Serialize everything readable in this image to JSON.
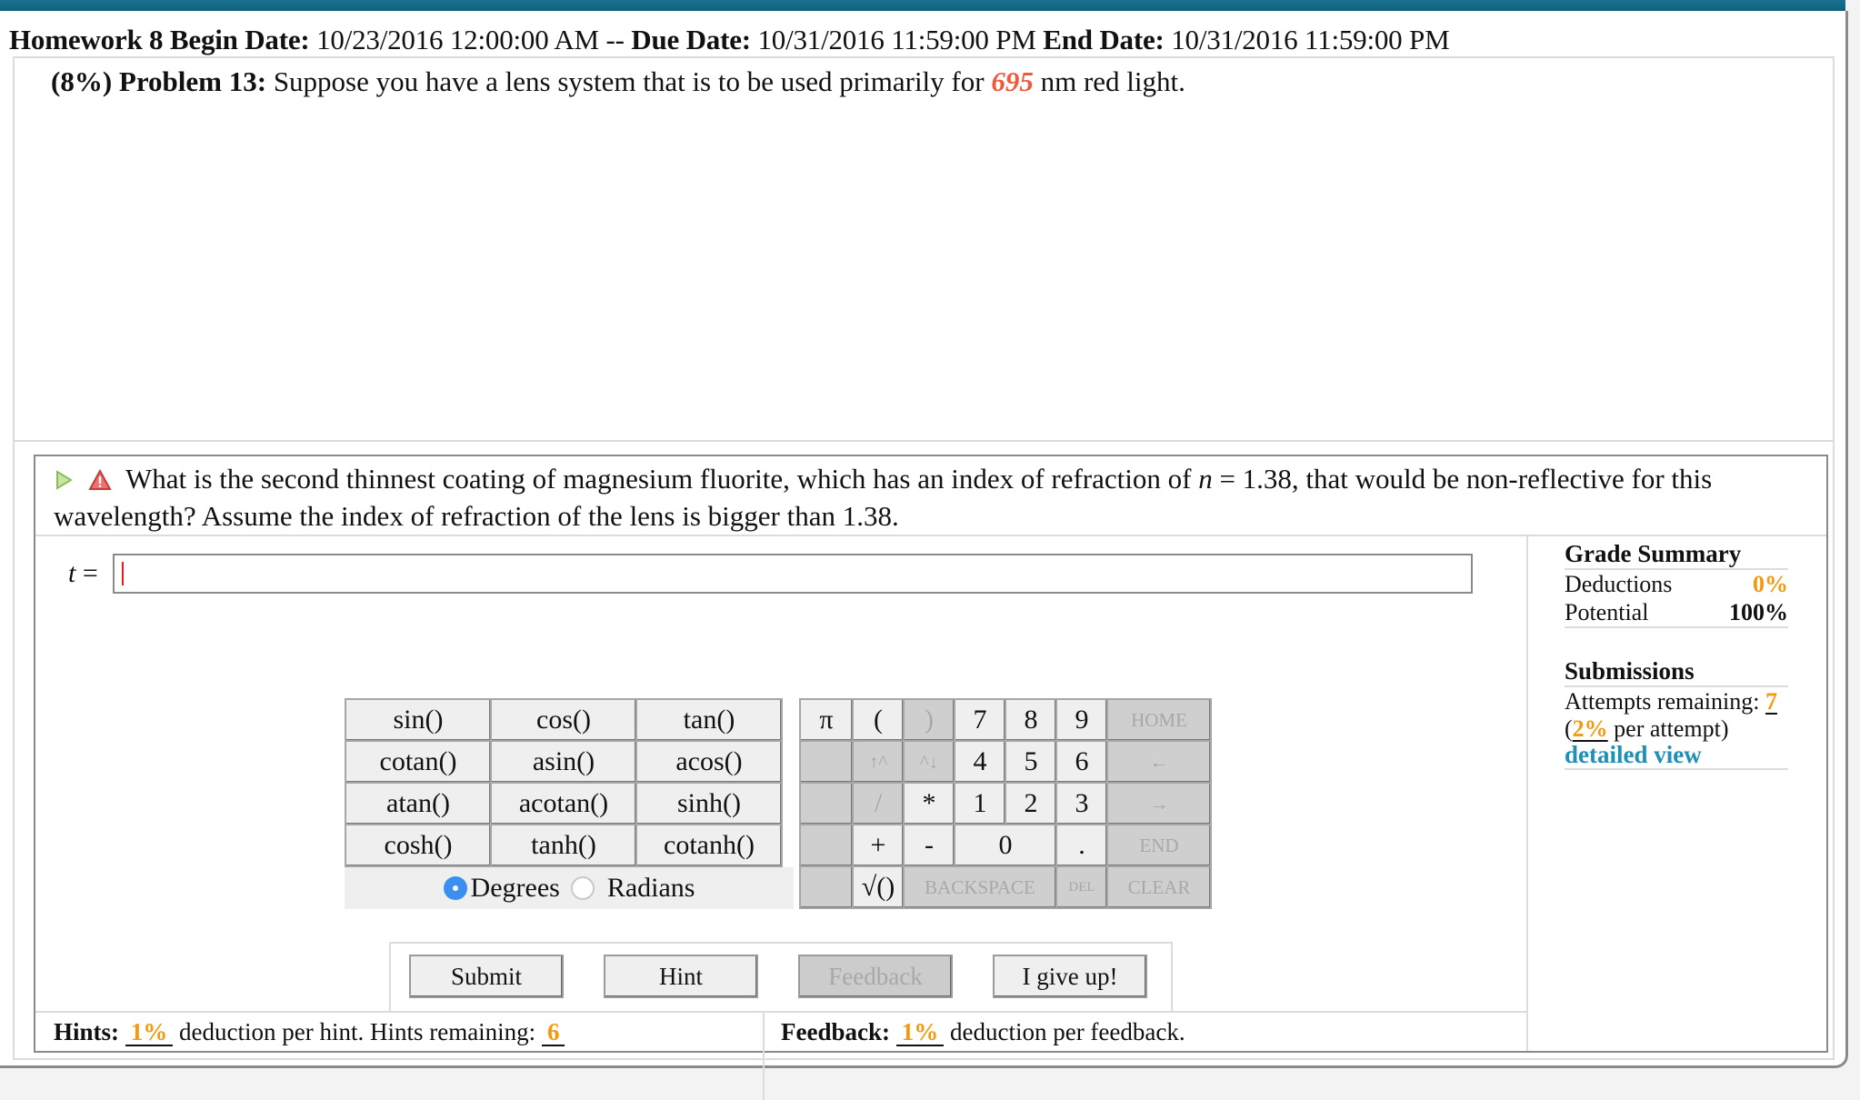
{
  "header": {
    "assignment": "Homework 8",
    "begin_label": "Begin Date:",
    "begin_value": "10/23/2016 12:00:00 AM",
    "sep": "--",
    "due_label": "Due Date:",
    "due_value": "10/31/2016 11:59:00 PM",
    "end_label": "End Date:",
    "end_value": "10/31/2016 11:59:00 PM"
  },
  "problem": {
    "weight": "(8%)",
    "number_label": "Problem 13:",
    "text_before": "Suppose you have a lens system that is to be used primarily for",
    "wavelength": "695",
    "text_after": "nm red light."
  },
  "question": {
    "icons": [
      "play-arrow-icon",
      "warning-icon"
    ],
    "text_1": "What is the second thinnest coating of magnesium fluorite, which has an index of refraction of",
    "n_var": "n",
    "text_2": "= 1.38, that would be non-reflective for this wavelength? Assume the index of refraction of the lens is bigger than 1.38."
  },
  "answer": {
    "var": "t",
    "eq": "=",
    "value": ""
  },
  "calculator": {
    "functions": [
      [
        "sin()",
        "cos()",
        "tan()"
      ],
      [
        "cotan()",
        "asin()",
        "acos()"
      ],
      [
        "atan()",
        "acotan()",
        "sinh()"
      ],
      [
        "cosh()",
        "tanh()",
        "cotanh()"
      ]
    ],
    "angle_mode": {
      "degrees": "Degrees",
      "radians": "Radians",
      "selected": "Degrees"
    },
    "keys": {
      "pi": "π",
      "lparen": "(",
      "rparen": ")",
      "k7": "7",
      "k8": "8",
      "k9": "9",
      "home": "HOME",
      "up": "↑^",
      "down": "^↓",
      "k4": "4",
      "k5": "5",
      "k6": "6",
      "left": "←",
      "div": "/",
      "mul": "*",
      "k1": "1",
      "k2": "2",
      "k3": "3",
      "right": "→",
      "plus": "+",
      "minus": "-",
      "k0": "0",
      "dot": ".",
      "end": "END",
      "sqrt": "√()",
      "backspace": "BACKSPACE",
      "del": "DEL",
      "clear": "CLEAR"
    }
  },
  "buttons": {
    "submit": "Submit",
    "hint": "Hint",
    "feedback": "Feedback",
    "give_up": "I give up!"
  },
  "hints": {
    "label": "Hints:",
    "deduction": "1%",
    "text": "deduction per hint. Hints remaining:",
    "remaining": "6"
  },
  "feedback": {
    "label": "Feedback:",
    "deduction": "1%",
    "text": "deduction per feedback."
  },
  "grade_summary": {
    "title": "Grade Summary",
    "deductions_label": "Deductions",
    "deductions_value": "0%",
    "potential_label": "Potential",
    "potential_value": "100%"
  },
  "submissions": {
    "title": "Submissions",
    "attempts_label": "Attempts remaining:",
    "attempts_value": "7",
    "per_attempt_open": "(",
    "per_attempt_value": "2%",
    "per_attempt_text": "per attempt)",
    "detailed_view": "detailed view"
  },
  "colors": {
    "accent_orange": "#f49a0f",
    "variable_red": "#f05a3a",
    "link_blue": "#1e8fb8",
    "topbar_teal": "#146a87",
    "radio_blue": "#3a8ff0"
  }
}
